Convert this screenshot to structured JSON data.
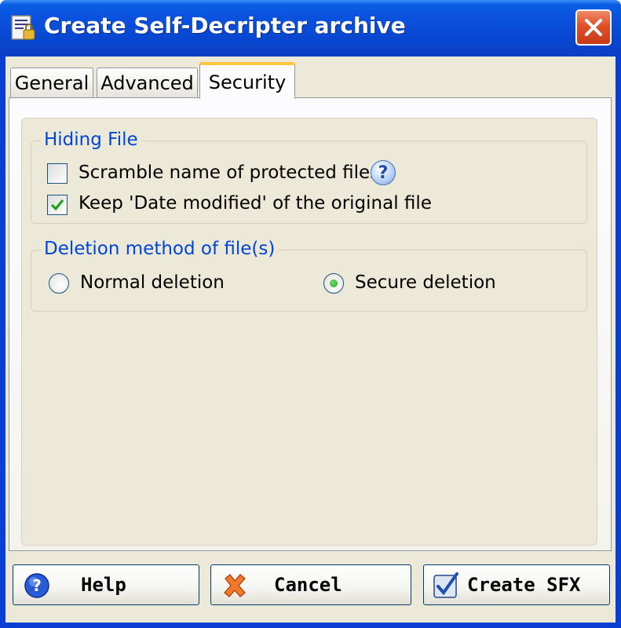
{
  "window": {
    "title": "Create Self-Decripter archive",
    "title_bar_color": "#0a52de"
  },
  "tabs": [
    {
      "label": "General",
      "active": false
    },
    {
      "label": "Advanced",
      "active": false
    },
    {
      "label": "Security",
      "active": true
    }
  ],
  "hiding_file": {
    "legend": "Hiding File",
    "scramble": {
      "label": "Scramble name of protected files",
      "checked": false,
      "help_icon": "help-icon"
    },
    "keep_date": {
      "label": "Keep 'Date modified' of the original file",
      "checked": true
    }
  },
  "deletion": {
    "legend": "Deletion method of file(s)",
    "options": [
      {
        "label": "Normal deletion",
        "selected": false
      },
      {
        "label": "Secure deletion",
        "selected": true
      }
    ]
  },
  "buttons": {
    "help": "Help",
    "cancel": "Cancel",
    "create": "Create SFX"
  },
  "colors": {
    "legend_text": "#0046d5",
    "checkmark": "#21a121",
    "radio_dot": "#21a121",
    "close_button": "#e0502a",
    "tab_highlight": "#ffc83c"
  }
}
